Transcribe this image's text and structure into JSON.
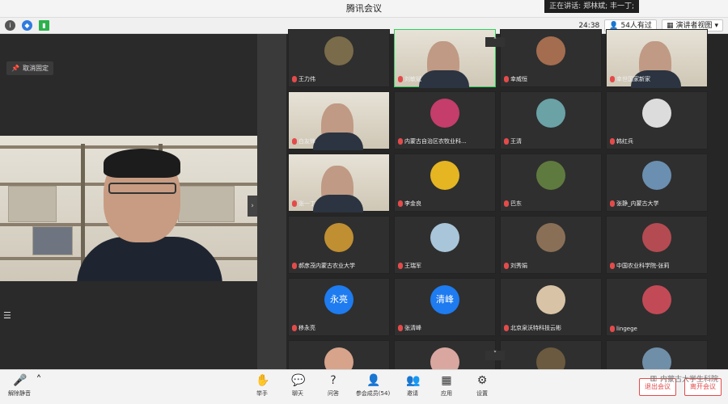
{
  "window": {
    "title": "腾讯会议",
    "speaking_banner": "正在讲话: 郑林斌; 丰一丁;"
  },
  "infobar": {
    "timer": "24:38",
    "participants_label": "54人有过",
    "view_label": "演讲者视图"
  },
  "left": {
    "pin_label": "取消固定"
  },
  "tiles": [
    {
      "name": "王力伟",
      "kind": "avatar",
      "color": "#7a6b4a"
    },
    {
      "name": "刘敏斌",
      "kind": "video",
      "active": true
    },
    {
      "name": "幸威恒",
      "kind": "avatar",
      "color": "#a46d4f"
    },
    {
      "name": "幸世国家新家",
      "kind": "video"
    },
    {
      "name": "白友锋",
      "kind": "video"
    },
    {
      "name": "内蒙古自治区农牧业科...",
      "kind": "avatar",
      "color": "#c43d6b"
    },
    {
      "name": "王清",
      "kind": "avatar",
      "color": "#6aa2a6"
    },
    {
      "name": "韩红兵",
      "kind": "avatar",
      "color": "#dcdcdc"
    },
    {
      "name": "张一丁",
      "kind": "video"
    },
    {
      "name": "李金良",
      "kind": "avatar",
      "color": "#e5b522"
    },
    {
      "name": "巴东",
      "kind": "avatar",
      "color": "#5f7a3e"
    },
    {
      "name": "张静_内蒙古大学",
      "kind": "avatar",
      "color": "#6b8fb0"
    },
    {
      "name": "郝彦茂内蒙古农业大学",
      "kind": "avatar",
      "color": "#c08f32"
    },
    {
      "name": "王瑞军",
      "kind": "avatar",
      "color": "#a9c5d9"
    },
    {
      "name": "刘秀娟",
      "kind": "avatar",
      "color": "#8a6f57"
    },
    {
      "name": "中国农业科学院-张莉",
      "kind": "avatar",
      "color": "#b44b52"
    },
    {
      "name": "移永亮",
      "kind": "text",
      "text": "永亮"
    },
    {
      "name": "张清峰",
      "kind": "text",
      "text": "清峰"
    },
    {
      "name": "北京泉沃特科技云彬",
      "kind": "avatar",
      "color": "#d8c3a6"
    },
    {
      "name": "lingege",
      "kind": "avatar",
      "color": "#c24a56"
    },
    {
      "name": "",
      "kind": "avatar",
      "color": "#d7a38b"
    },
    {
      "name": "",
      "kind": "avatar",
      "color": "#d9a7a0"
    },
    {
      "name": "",
      "kind": "avatar",
      "color": "#6b5a3f"
    },
    {
      "name": "",
      "kind": "avatar",
      "color": "#6f8ea8"
    }
  ],
  "toolbar": {
    "unmute": "解除静音",
    "raise_hand": "举手",
    "chat": "聊天",
    "qa": "问答",
    "members": "参会成员(54)",
    "invite": "邀请",
    "apps": "应用",
    "settings": "设置",
    "leave": "退出会议",
    "end": "离开会议",
    "watermark": "内蒙古大学生科院"
  }
}
